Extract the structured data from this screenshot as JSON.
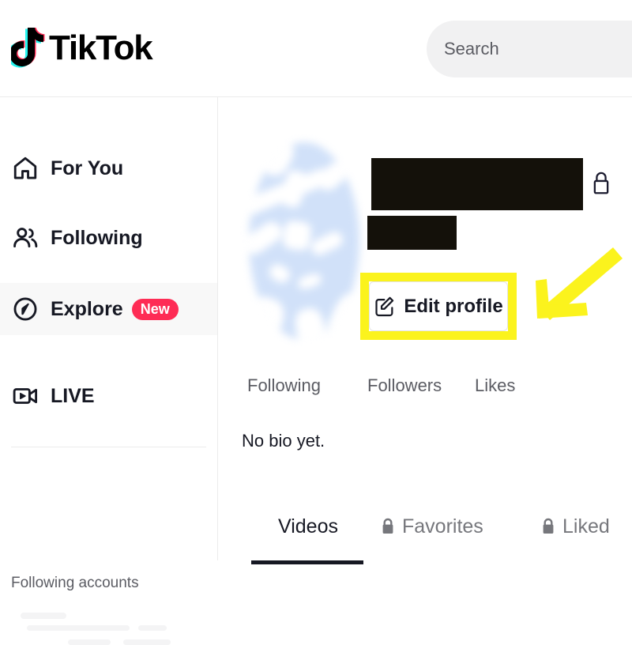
{
  "app": {
    "brand_name": "TikTok",
    "accent_color": "#fe2c55",
    "accent_cyan": "#25f4ee",
    "highlight_color": "#fbf31d"
  },
  "header": {
    "logo_label": "TikTok",
    "logo_icon": "tiktok-note-icon",
    "search": {
      "placeholder": "Search",
      "value": "",
      "icon": "search-icon"
    }
  },
  "sidebar": {
    "items": [
      {
        "label": "For You",
        "icon": "home-icon",
        "active": false,
        "badge": null
      },
      {
        "label": "Following",
        "icon": "people-icon",
        "active": false,
        "badge": "dot"
      },
      {
        "label": "Explore",
        "icon": "compass-icon",
        "active": true,
        "badge": "New"
      },
      {
        "label": "LIVE",
        "icon": "live-video-icon",
        "active": false,
        "badge": null
      }
    ],
    "section_title": "Following accounts"
  },
  "profile": {
    "avatar_icon": "user-avatar-image",
    "display_name_redacted": "",
    "handle_redacted": "",
    "private_account_icon": "lock-icon",
    "edit_profile": {
      "label": "Edit profile",
      "icon": "edit-pencil-icon"
    },
    "annotation_arrow": "yellow-arrow-icon",
    "stats": [
      {
        "label": "Following",
        "count": ""
      },
      {
        "label": "Followers",
        "count": ""
      },
      {
        "label": "Likes",
        "count": ""
      }
    ],
    "bio": "No bio yet."
  },
  "content_tabs": [
    {
      "label": "Videos",
      "locked": false,
      "active": true
    },
    {
      "label": "Favorites",
      "locked": true,
      "active": false
    },
    {
      "label": "Liked",
      "locked": true,
      "active": false
    }
  ]
}
